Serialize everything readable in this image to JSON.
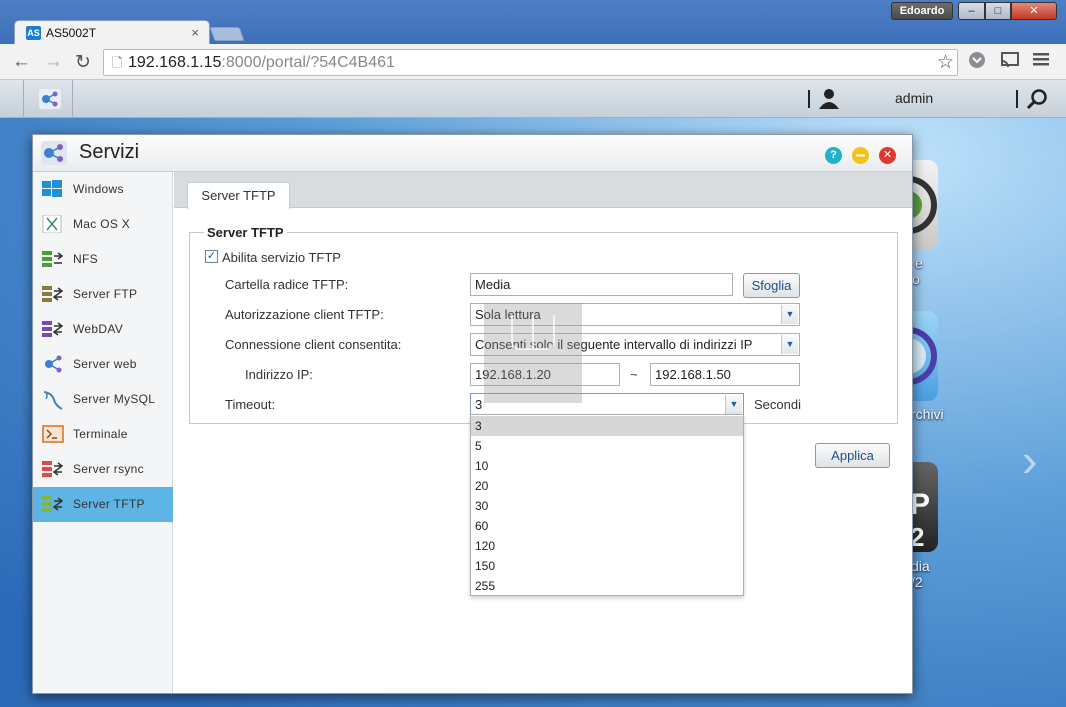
{
  "os": {
    "user_badge": "Edoardo",
    "min_glyph": "–",
    "max_glyph": "□",
    "close_glyph": "✕"
  },
  "browser": {
    "tab_favicon": "AS",
    "tab_title": "AS5002T",
    "tab_close": "×",
    "url_host": "192.168.1.15",
    "url_rest": ":8000/portal/?54C4B461"
  },
  "adm": {
    "user": "admin"
  },
  "desktop": {
    "labels": [
      "e",
      "o",
      "rchivi",
      "dia",
      "/2"
    ]
  },
  "window": {
    "title": "Servizi",
    "help_glyph": "?",
    "close_glyph": "✕",
    "sidebar": [
      {
        "label": "Windows"
      },
      {
        "label": "Mac OS X"
      },
      {
        "label": "NFS"
      },
      {
        "label": "Server FTP"
      },
      {
        "label": "WebDAV"
      },
      {
        "label": "Server web"
      },
      {
        "label": "Server MySQL"
      },
      {
        "label": "Terminale"
      },
      {
        "label": "Server rsync"
      },
      {
        "label": "Server TFTP"
      }
    ],
    "active_index": 9,
    "tab": "Server TFTP",
    "group_title": "Server TFTP",
    "enable_label": "Abilita servizio TFTP",
    "enable_checked": true,
    "root_label": "Cartella radice TFTP:",
    "root_value": "Media",
    "browse_button": "Sfoglia",
    "auth_label": "Autorizzazione client TFTP:",
    "auth_value": "Sola lettura",
    "conn_label": "Connessione client consentita:",
    "conn_value": "Consenti solo il seguente intervallo di indirizzi IP",
    "ip_label": "Indirizzo IP:",
    "ip_from": "192.168.1.20",
    "ip_sep": "~",
    "ip_to": "192.168.1.50",
    "timeout_label": "Timeout:",
    "timeout_value": "3",
    "timeout_unit": "Secondi",
    "timeout_options": [
      "3",
      "5",
      "10",
      "20",
      "30",
      "60",
      "120",
      "150",
      "255"
    ],
    "apply_button": "Applica"
  },
  "colors": {
    "sidebar_active": "#5fb4e6",
    "help": "#1fb2c9",
    "minimize": "#f3c21a",
    "close": "#e2392f"
  }
}
